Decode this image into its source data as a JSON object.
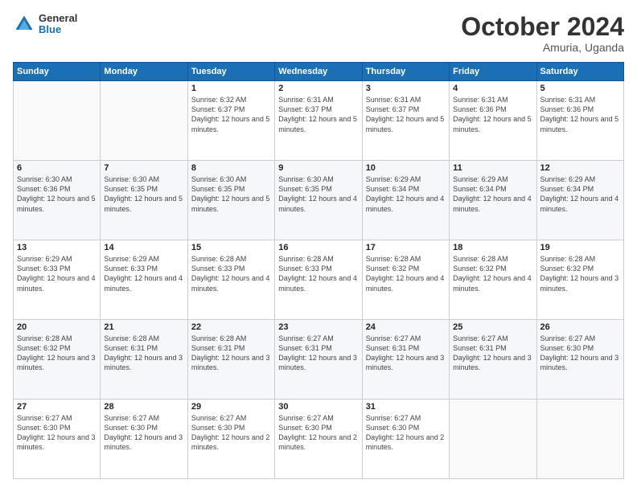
{
  "logo": {
    "general": "General",
    "blue": "Blue"
  },
  "header": {
    "month": "October 2024",
    "location": "Amuria, Uganda"
  },
  "weekdays": [
    "Sunday",
    "Monday",
    "Tuesday",
    "Wednesday",
    "Thursday",
    "Friday",
    "Saturday"
  ],
  "weeks": [
    [
      {
        "day": "",
        "detail": ""
      },
      {
        "day": "",
        "detail": ""
      },
      {
        "day": "1",
        "detail": "Sunrise: 6:32 AM\nSunset: 6:37 PM\nDaylight: 12 hours\nand 5 minutes."
      },
      {
        "day": "2",
        "detail": "Sunrise: 6:31 AM\nSunset: 6:37 PM\nDaylight: 12 hours\nand 5 minutes."
      },
      {
        "day": "3",
        "detail": "Sunrise: 6:31 AM\nSunset: 6:37 PM\nDaylight: 12 hours\nand 5 minutes."
      },
      {
        "day": "4",
        "detail": "Sunrise: 6:31 AM\nSunset: 6:36 PM\nDaylight: 12 hours\nand 5 minutes."
      },
      {
        "day": "5",
        "detail": "Sunrise: 6:31 AM\nSunset: 6:36 PM\nDaylight: 12 hours\nand 5 minutes."
      }
    ],
    [
      {
        "day": "6",
        "detail": "Sunrise: 6:30 AM\nSunset: 6:36 PM\nDaylight: 12 hours\nand 5 minutes."
      },
      {
        "day": "7",
        "detail": "Sunrise: 6:30 AM\nSunset: 6:35 PM\nDaylight: 12 hours\nand 5 minutes."
      },
      {
        "day": "8",
        "detail": "Sunrise: 6:30 AM\nSunset: 6:35 PM\nDaylight: 12 hours\nand 5 minutes."
      },
      {
        "day": "9",
        "detail": "Sunrise: 6:30 AM\nSunset: 6:35 PM\nDaylight: 12 hours\nand 4 minutes."
      },
      {
        "day": "10",
        "detail": "Sunrise: 6:29 AM\nSunset: 6:34 PM\nDaylight: 12 hours\nand 4 minutes."
      },
      {
        "day": "11",
        "detail": "Sunrise: 6:29 AM\nSunset: 6:34 PM\nDaylight: 12 hours\nand 4 minutes."
      },
      {
        "day": "12",
        "detail": "Sunrise: 6:29 AM\nSunset: 6:34 PM\nDaylight: 12 hours\nand 4 minutes."
      }
    ],
    [
      {
        "day": "13",
        "detail": "Sunrise: 6:29 AM\nSunset: 6:33 PM\nDaylight: 12 hours\nand 4 minutes."
      },
      {
        "day": "14",
        "detail": "Sunrise: 6:29 AM\nSunset: 6:33 PM\nDaylight: 12 hours\nand 4 minutes."
      },
      {
        "day": "15",
        "detail": "Sunrise: 6:28 AM\nSunset: 6:33 PM\nDaylight: 12 hours\nand 4 minutes."
      },
      {
        "day": "16",
        "detail": "Sunrise: 6:28 AM\nSunset: 6:33 PM\nDaylight: 12 hours\nand 4 minutes."
      },
      {
        "day": "17",
        "detail": "Sunrise: 6:28 AM\nSunset: 6:32 PM\nDaylight: 12 hours\nand 4 minutes."
      },
      {
        "day": "18",
        "detail": "Sunrise: 6:28 AM\nSunset: 6:32 PM\nDaylight: 12 hours\nand 4 minutes."
      },
      {
        "day": "19",
        "detail": "Sunrise: 6:28 AM\nSunset: 6:32 PM\nDaylight: 12 hours\nand 3 minutes."
      }
    ],
    [
      {
        "day": "20",
        "detail": "Sunrise: 6:28 AM\nSunset: 6:32 PM\nDaylight: 12 hours\nand 3 minutes."
      },
      {
        "day": "21",
        "detail": "Sunrise: 6:28 AM\nSunset: 6:31 PM\nDaylight: 12 hours\nand 3 minutes."
      },
      {
        "day": "22",
        "detail": "Sunrise: 6:28 AM\nSunset: 6:31 PM\nDaylight: 12 hours\nand 3 minutes."
      },
      {
        "day": "23",
        "detail": "Sunrise: 6:27 AM\nSunset: 6:31 PM\nDaylight: 12 hours\nand 3 minutes."
      },
      {
        "day": "24",
        "detail": "Sunrise: 6:27 AM\nSunset: 6:31 PM\nDaylight: 12 hours\nand 3 minutes."
      },
      {
        "day": "25",
        "detail": "Sunrise: 6:27 AM\nSunset: 6:31 PM\nDaylight: 12 hours\nand 3 minutes."
      },
      {
        "day": "26",
        "detail": "Sunrise: 6:27 AM\nSunset: 6:30 PM\nDaylight: 12 hours\nand 3 minutes."
      }
    ],
    [
      {
        "day": "27",
        "detail": "Sunrise: 6:27 AM\nSunset: 6:30 PM\nDaylight: 12 hours\nand 3 minutes."
      },
      {
        "day": "28",
        "detail": "Sunrise: 6:27 AM\nSunset: 6:30 PM\nDaylight: 12 hours\nand 3 minutes."
      },
      {
        "day": "29",
        "detail": "Sunrise: 6:27 AM\nSunset: 6:30 PM\nDaylight: 12 hours\nand 2 minutes."
      },
      {
        "day": "30",
        "detail": "Sunrise: 6:27 AM\nSunset: 6:30 PM\nDaylight: 12 hours\nand 2 minutes."
      },
      {
        "day": "31",
        "detail": "Sunrise: 6:27 AM\nSunset: 6:30 PM\nDaylight: 12 hours\nand 2 minutes."
      },
      {
        "day": "",
        "detail": ""
      },
      {
        "day": "",
        "detail": ""
      }
    ]
  ]
}
